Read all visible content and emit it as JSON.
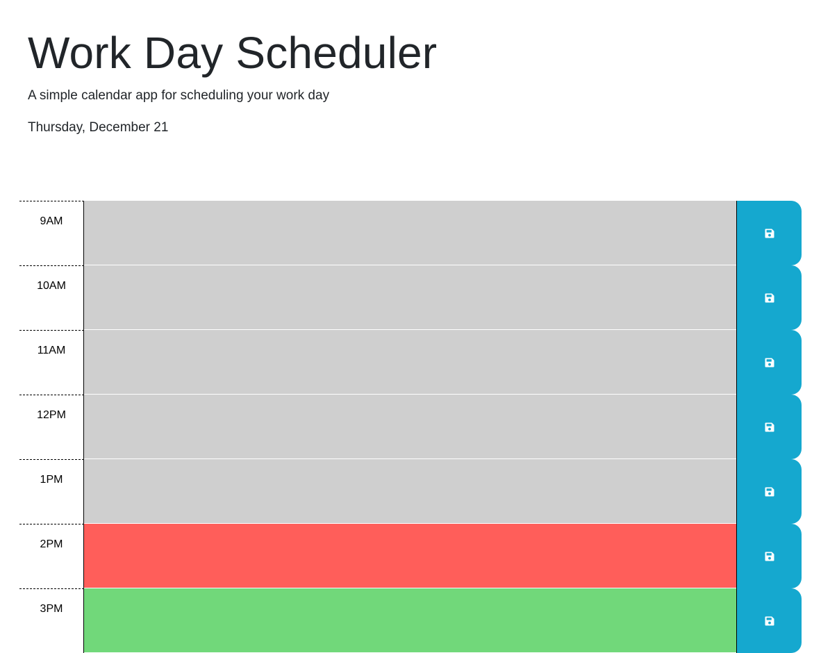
{
  "header": {
    "title": "Work Day Scheduler",
    "subtitle": "A simple calendar app for scheduling your work day",
    "current_day": "Thursday, December 21"
  },
  "colors": {
    "past": "#cfcfcf",
    "present": "#ff5e5a",
    "future": "#71d87a",
    "save_button": "#15a8cf"
  },
  "save_icon": "floppy-disk-icon",
  "timeblocks": [
    {
      "hour": "9AM",
      "text": "",
      "status": "past"
    },
    {
      "hour": "10AM",
      "text": "",
      "status": "past"
    },
    {
      "hour": "11AM",
      "text": "",
      "status": "past"
    },
    {
      "hour": "12PM",
      "text": "",
      "status": "past"
    },
    {
      "hour": "1PM",
      "text": "",
      "status": "past"
    },
    {
      "hour": "2PM",
      "text": "",
      "status": "present"
    },
    {
      "hour": "3PM",
      "text": "",
      "status": "future"
    }
  ]
}
